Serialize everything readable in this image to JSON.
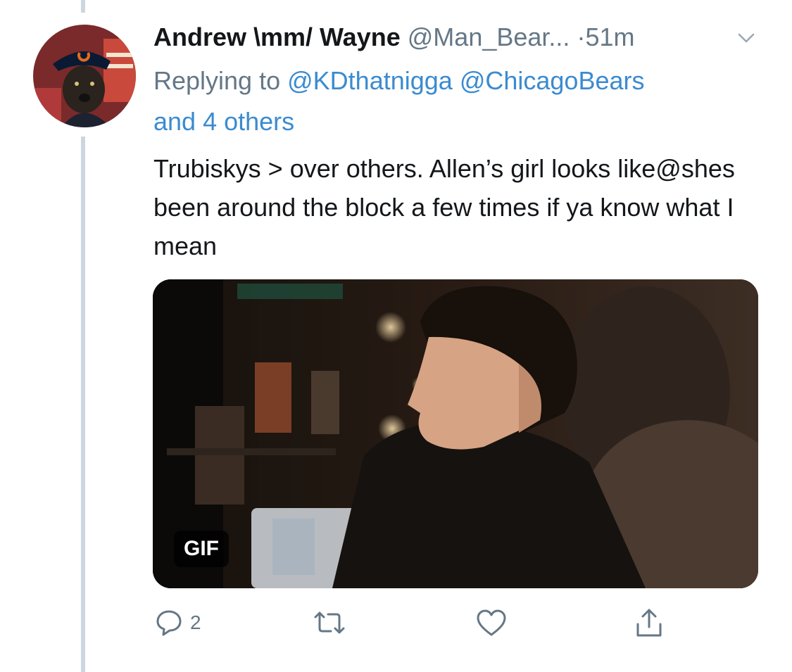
{
  "tweet": {
    "author": {
      "display_name": "Andrew \\mm/ Wayne",
      "handle": "@Man_Bear...",
      "avatar_icon": "dog-in-bears-cap-avatar"
    },
    "separator": "·",
    "timestamp": "51m",
    "replying_prefix": "Replying to",
    "replying_mentions": [
      "@KDthatnigga",
      "@ChicagoBears"
    ],
    "replying_others": "and 4 others",
    "text": "Trubiskys > over others. Allen’s girl looks like@shes been around the block a few times if ya know what I mean",
    "media": {
      "type": "gif",
      "badge": "GIF"
    },
    "actions": {
      "reply_icon": "speech-bubble-icon",
      "reply_count": "2",
      "retweet_icon": "retweet-icon",
      "like_icon": "heart-icon",
      "share_icon": "share-icon"
    }
  },
  "colors": {
    "link": "#3b8bd0",
    "secondary_text": "#657786",
    "thread_line": "#cdd6e0"
  }
}
